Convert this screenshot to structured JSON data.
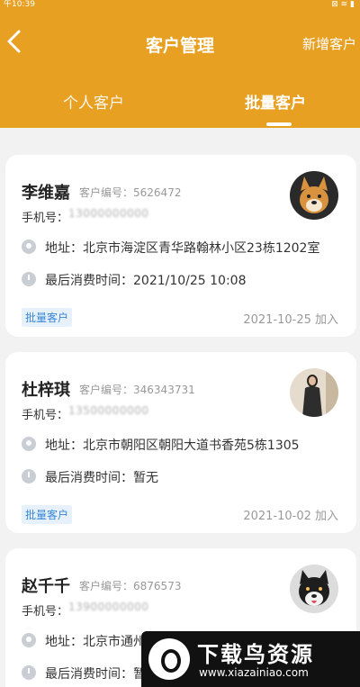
{
  "status_bar": {
    "time": "午10:39",
    "icons": "⊠ ≋ ▮"
  },
  "header": {
    "title": "客户管理",
    "back_icon": "chevron-left-icon",
    "add_button": "新增客户",
    "tabs": [
      {
        "label": "个人客户",
        "active": false
      },
      {
        "label": "批量客户",
        "active": true
      }
    ],
    "accent_color": "#e8a022"
  },
  "customers": [
    {
      "name": "李维嘉",
      "code_label": "客户编号：",
      "code": "5626472",
      "phone_label": "手机号：",
      "phone": "13000000000",
      "address": "地址：北京市海淀区青华路翰林小区23栋1202室",
      "last_consume": "最后消费时间：2021/10/25 10:08",
      "badge": "批量客户",
      "joined": "2021-10-25 加入"
    },
    {
      "name": "杜梓琪",
      "code_label": "客户编号：",
      "code": "346343731",
      "phone_label": "手机号：",
      "phone": "13500000000",
      "address": "地址：北京市朝阳区朝阳大道书香苑5栋1305",
      "last_consume": "最后消费时间：暂无",
      "badge": "批量客户",
      "joined": "2021-10-02 加入"
    },
    {
      "name": "赵千千",
      "code_label": "客户编号：",
      "code": "6876573",
      "phone_label": "手机号：",
      "phone": "13900000000",
      "address": "地址：北京市通州",
      "last_consume": "最后消费时间：暂",
      "badge": "",
      "joined": ""
    }
  ],
  "watermark": {
    "title": "下载鸟资源",
    "url": "www.xiazainiao.com"
  }
}
